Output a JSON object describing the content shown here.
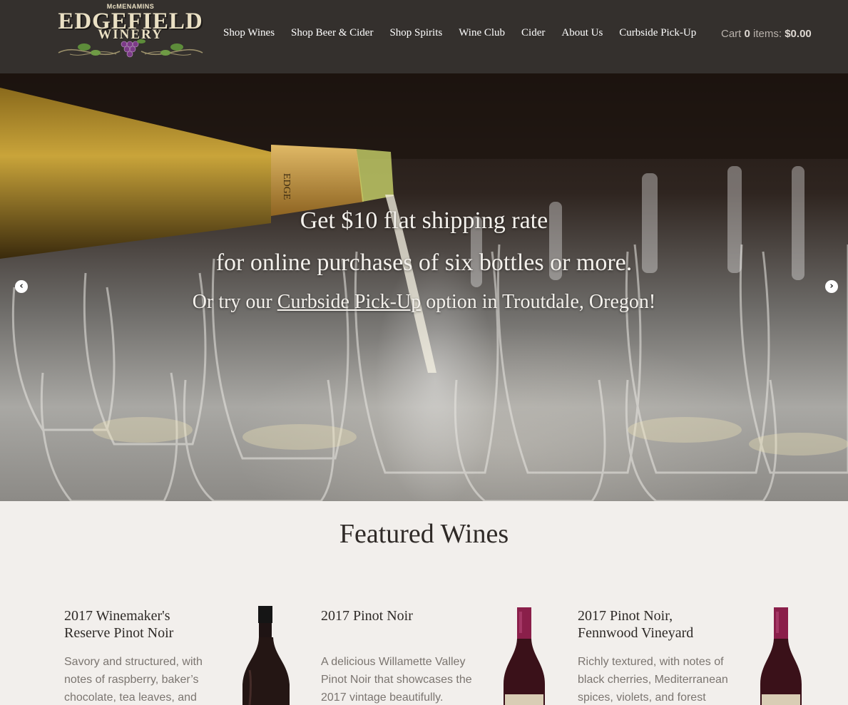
{
  "brand": {
    "small": "McMENAMINS",
    "big": "EDGEFIELD",
    "mid": "WINERY"
  },
  "nav": {
    "items": [
      "Shop Wines",
      "Shop Beer & Cider",
      "Shop Spirits",
      "Wine Club",
      "Cider",
      "About Us",
      "Curbside Pick-Up"
    ]
  },
  "cart": {
    "label": "Cart",
    "count": "0",
    "items_label": "items:",
    "total": "$0.00"
  },
  "hero": {
    "line1": "Get $10 flat shipping rate",
    "line2": "for online purchases of six bottles or more.",
    "line3_prefix": "Or try our",
    "line3_link": "Curbside Pick-Up",
    "line3_suffix": "option in Troutdale, Oregon!",
    "bottle_label": "EDGE"
  },
  "featured": {
    "title": "Featured Wines",
    "wines": [
      {
        "title_line1": "2017 Winemaker's",
        "title_line2": "Reserve Pinot Noir",
        "desc_lines": [
          "Savory and structured, with",
          "notes of raspberry, baker’s",
          "chocolate, tea leaves, and"
        ]
      },
      {
        "title_line1": "2017 Pinot Noir",
        "title_line2": "",
        "desc_lines": [
          "A delicious Willamette Valley",
          "Pinot Noir that showcases the",
          "2017 vintage beautifully."
        ]
      },
      {
        "title_line1": "2017 Pinot Noir,",
        "title_line2": "Fennwood Vineyard",
        "desc_lines": [
          "Richly textured, with notes of",
          "black cherries, Mediterranean",
          "spices, violets, and forest"
        ]
      }
    ]
  },
  "colors": {
    "header_bg": "#34302d",
    "page_bg": "#f2efec",
    "accent_cream": "#eae0c4",
    "grape_purple": "#7b3a87"
  }
}
